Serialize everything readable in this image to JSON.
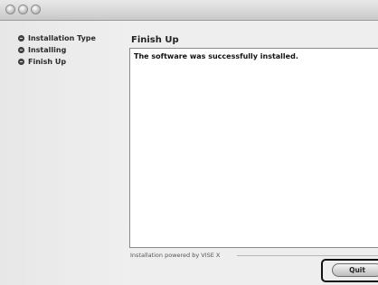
{
  "window": {
    "title": "",
    "controls": [
      "close",
      "minimize",
      "zoom"
    ]
  },
  "sidebar": {
    "steps": [
      {
        "label": "Installation Type"
      },
      {
        "label": "Installing"
      },
      {
        "label": "Finish Up"
      }
    ]
  },
  "main": {
    "section_title": "Finish Up",
    "message": "The software was successfully installed.",
    "powered_by": "Installation powered by VISE X"
  },
  "actions": {
    "quit_label": "Quit"
  }
}
